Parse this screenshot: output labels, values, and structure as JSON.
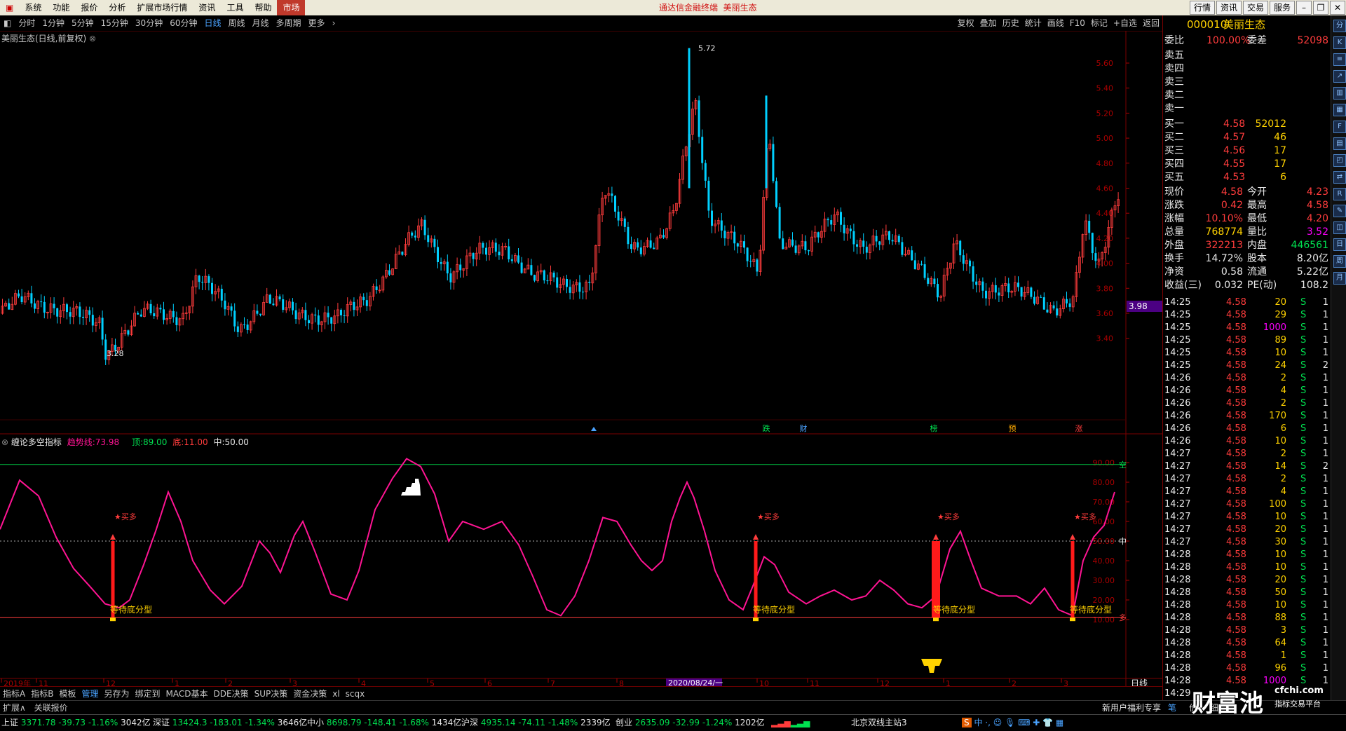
{
  "menu": {
    "items": [
      "系统",
      "功能",
      "报价",
      "分析",
      "扩展市场行情",
      "资讯",
      "工具",
      "帮助"
    ],
    "market_tab": "市场",
    "title_app": "通达信金融终端",
    "title_stock": "美丽生态",
    "right_buttons": [
      "行情",
      "资讯",
      "交易",
      "服务"
    ]
  },
  "toolbar": {
    "periods": [
      "分时",
      "1分钟",
      "5分钟",
      "15分钟",
      "30分钟",
      "60分钟",
      "日线",
      "周线",
      "月线",
      "多周期",
      "更多"
    ],
    "active_period": "日线",
    "tools": [
      "复权",
      "叠加",
      "历史",
      "统计",
      "画线",
      "F10",
      "标记",
      "+自选",
      "返回"
    ]
  },
  "chart": {
    "main_title": "美丽生态(日线,前复权)",
    "price_ticks": [
      "5.60",
      "5.40",
      "5.20",
      "5.00",
      "4.80",
      "4.60",
      "4.40",
      "4.20",
      "4.00",
      "3.80",
      "3.60",
      "3.40"
    ],
    "current_price_tag": "3.98",
    "high_label": "5.72",
    "low_label": "3.28",
    "event_marks": [
      "跌",
      "财",
      "榜",
      "预",
      "涨"
    ],
    "indicator": {
      "name": "缠论多空指标",
      "trend_label": "趋势线:",
      "trend_value": "73.98",
      "top_label": "顶:",
      "top_value": "89.00",
      "bottom_label": "底:",
      "bottom_value": "11.00",
      "mid_label": "中:",
      "mid_value": "50.00",
      "ticks": [
        "90.00",
        "80.00",
        "70.00",
        "60.00",
        "50.00",
        "40.00",
        "30.00",
        "20.00",
        "10.00"
      ],
      "line_labels": {
        "top": "空",
        "mid": "中",
        "bottom": "多"
      },
      "buy_label": "买多",
      "wait_label": "等待底分型"
    },
    "date_axis": [
      "2019年",
      "11",
      "12",
      "1",
      "2",
      "3",
      "4",
      "5",
      "6",
      "7",
      "8",
      "9",
      "10",
      "11",
      "12",
      "1",
      "2",
      "3"
    ],
    "date_highlight": "2020/08/24/一",
    "period_label": "日线"
  },
  "quote": {
    "code": "000010",
    "name": "美丽生态",
    "weibi_label": "委比",
    "weibi_value": "100.00%",
    "weicha_label": "委差",
    "weicha_value": "52098",
    "sell_labels": [
      "卖五",
      "卖四",
      "卖三",
      "卖二",
      "卖一"
    ],
    "buy_rows": [
      {
        "label": "买一",
        "price": "4.58",
        "vol": "52012"
      },
      {
        "label": "买二",
        "price": "4.57",
        "vol": "46"
      },
      {
        "label": "买三",
        "price": "4.56",
        "vol": "17"
      },
      {
        "label": "买四",
        "price": "4.55",
        "vol": "17"
      },
      {
        "label": "买五",
        "price": "4.53",
        "vol": "6"
      }
    ],
    "stats": [
      {
        "l1": "现价",
        "v1": "4.58",
        "l2": "今开",
        "v2": "4.23"
      },
      {
        "l1": "涨跌",
        "v1": "0.42",
        "l2": "最高",
        "v2": "4.58"
      },
      {
        "l1": "涨幅",
        "v1": "10.10%",
        "l2": "最低",
        "v2": "4.20"
      },
      {
        "l1": "总量",
        "v1": "768774",
        "l2": "量比",
        "v2": "3.52"
      },
      {
        "l1": "外盘",
        "v1": "322213",
        "l2": "内盘",
        "v2": "446561"
      },
      {
        "l1": "换手",
        "v1": "14.72%",
        "l2": "股本",
        "v2": "8.20亿"
      },
      {
        "l1": "净资",
        "v1": "0.58",
        "l2": "流通",
        "v2": "5.22亿"
      },
      {
        "l1": "收益(三)",
        "v1": "0.032",
        "l2": "PE(动)",
        "v2": "108.2"
      }
    ],
    "ticks": [
      [
        "14:25",
        "4.58",
        "20",
        "S",
        "1"
      ],
      [
        "14:25",
        "4.58",
        "29",
        "S",
        "1"
      ],
      [
        "14:25",
        "4.58",
        "1000",
        "S",
        "1"
      ],
      [
        "14:25",
        "4.58",
        "89",
        "S",
        "1"
      ],
      [
        "14:25",
        "4.58",
        "10",
        "S",
        "1"
      ],
      [
        "14:25",
        "4.58",
        "24",
        "S",
        "2"
      ],
      [
        "14:26",
        "4.58",
        "2",
        "S",
        "1"
      ],
      [
        "14:26",
        "4.58",
        "4",
        "S",
        "1"
      ],
      [
        "14:26",
        "4.58",
        "2",
        "S",
        "1"
      ],
      [
        "14:26",
        "4.58",
        "170",
        "S",
        "1"
      ],
      [
        "14:26",
        "4.58",
        "6",
        "S",
        "1"
      ],
      [
        "14:26",
        "4.58",
        "10",
        "S",
        "1"
      ],
      [
        "14:27",
        "4.58",
        "2",
        "S",
        "1"
      ],
      [
        "14:27",
        "4.58",
        "14",
        "S",
        "2"
      ],
      [
        "14:27",
        "4.58",
        "2",
        "S",
        "1"
      ],
      [
        "14:27",
        "4.58",
        "4",
        "S",
        "1"
      ],
      [
        "14:27",
        "4.58",
        "100",
        "S",
        "1"
      ],
      [
        "14:27",
        "4.58",
        "10",
        "S",
        "1"
      ],
      [
        "14:27",
        "4.58",
        "20",
        "S",
        "1"
      ],
      [
        "14:27",
        "4.58",
        "30",
        "S",
        "1"
      ],
      [
        "14:28",
        "4.58",
        "10",
        "S",
        "1"
      ],
      [
        "14:28",
        "4.58",
        "10",
        "S",
        "1"
      ],
      [
        "14:28",
        "4.58",
        "20",
        "S",
        "1"
      ],
      [
        "14:28",
        "4.58",
        "50",
        "S",
        "1"
      ],
      [
        "14:28",
        "4.58",
        "10",
        "S",
        "1"
      ],
      [
        "14:28",
        "4.58",
        "88",
        "S",
        "1"
      ],
      [
        "14:28",
        "4.58",
        "3",
        "S",
        "1"
      ],
      [
        "14:28",
        "4.58",
        "64",
        "S",
        "1"
      ],
      [
        "14:28",
        "4.58",
        "1",
        "S",
        "1"
      ],
      [
        "14:28",
        "4.58",
        "96",
        "S",
        "1"
      ],
      [
        "14:28",
        "4.58",
        "1000",
        "S",
        "1"
      ],
      [
        "14:29",
        "",
        "",
        "",
        ""
      ]
    ]
  },
  "bottom_tabs": [
    "指标A",
    "指标B",
    "模板",
    "管理",
    "另存为",
    "绑定到",
    "MACD基本",
    "DDE决策",
    "SUP决策",
    "资金决策",
    "xl",
    "scqx"
  ],
  "active_tab": "管理",
  "ext_bar": [
    "扩展∧",
    "关联报价"
  ],
  "ext_right": [
    "新用户福利专享",
    "笔",
    "价",
    "细"
  ],
  "indices": [
    {
      "name": "上证",
      "value": "3371.78",
      "chg": "-39.73",
      "pct": "-1.16%",
      "amt": "3042亿"
    },
    {
      "name": "深证",
      "value": "13424.3",
      "chg": "-183.01",
      "pct": "-1.34%",
      "amt": "3646亿"
    },
    {
      "name": "中小",
      "value": "8698.79",
      "chg": "-148.41",
      "pct": "-1.68%",
      "amt": "1434亿"
    },
    {
      "name": "沪深",
      "value": "4935.14",
      "chg": "-74.11",
      "pct": "-1.48%",
      "amt": "2339亿"
    },
    {
      "name": "创业",
      "value": "2635.09",
      "chg": "-32.99",
      "pct": "-1.24%",
      "amt": "1202亿"
    }
  ],
  "server": "北京双线主站3",
  "watermark": {
    "brand": "财富池",
    "domain": "cfchi.com",
    "slogan": "指标交易平台"
  },
  "colors": {
    "up": "#ff3c3c",
    "down": "#00d0ff",
    "oscillator": "#ff1493",
    "bg": "#000000"
  }
}
